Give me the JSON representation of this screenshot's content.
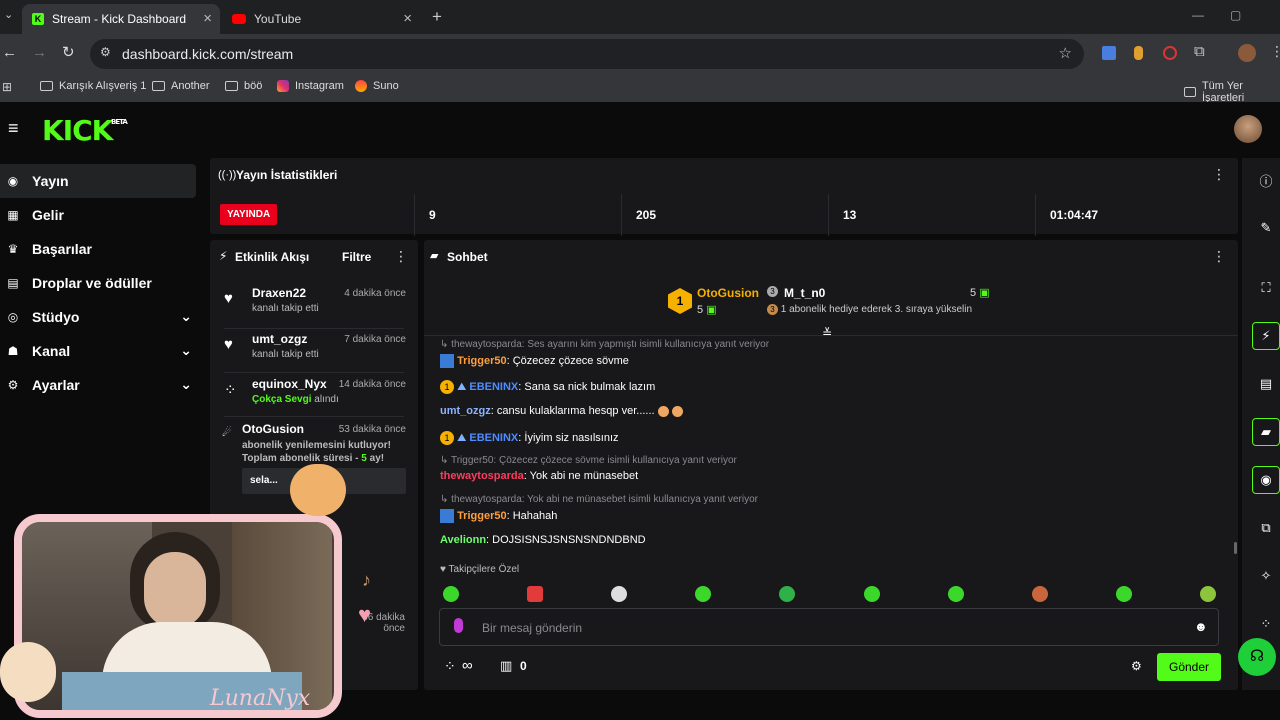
{
  "browser": {
    "tabs": [
      {
        "label": "Stream - Kick Dashboard",
        "active": true
      },
      {
        "label": "YouTube",
        "active": false
      }
    ],
    "url": "dashboard.kick.com/stream",
    "bookmarks": [
      "Karışık Alışveriş 1",
      "Another",
      "böö",
      "Instagram",
      "Suno"
    ],
    "bookmarks_right": "Tüm Yer İşaretleri"
  },
  "brand": {
    "logo": "KICK",
    "beta": "BETA",
    "accent": "#53fc18"
  },
  "sidebar": {
    "items": [
      {
        "label": "Yayın",
        "icon": "broadcast-icon",
        "active": true
      },
      {
        "label": "Gelir",
        "icon": "revenue-icon"
      },
      {
        "label": "Başarılar",
        "icon": "trophy-icon"
      },
      {
        "label": "Droplar ve ödüller",
        "icon": "gift-icon"
      },
      {
        "label": "Stüdyo",
        "icon": "studio-icon",
        "expandable": true
      },
      {
        "label": "Kanal",
        "icon": "channel-icon",
        "expandable": true
      },
      {
        "label": "Ayarlar",
        "icon": "gear-icon",
        "expandable": true
      }
    ]
  },
  "stats": {
    "title": "Yayın İstatistikleri",
    "live_badge": "YAYINDA",
    "values": [
      "9",
      "205",
      "13",
      "01:04:47"
    ]
  },
  "activity": {
    "title": "Etkinlik Akışı",
    "filter": "Filtre",
    "items": [
      {
        "name": "Draxen22",
        "time": "4 dakika önce",
        "text": "kanalı takip etti"
      },
      {
        "name": "umt_ozgz",
        "time": "7 dakika önce",
        "text": "kanalı takip etti"
      },
      {
        "name": "equinox_Nyx",
        "time": "14 dakika önce",
        "highlight": "Çokça Sevgi",
        "text": "alındı"
      },
      {
        "name": "OtoGusion",
        "time": "53 dakika önce",
        "line1": "abonelik yenilemesini kutluyor!",
        "line2a": "Toplam abonelik süresi -",
        "line2b": "5",
        "line2c": "ay!",
        "msg": "sela..."
      },
      {
        "time": "56 dakika önce"
      }
    ]
  },
  "chat": {
    "title": "Sohbet",
    "pinned": {
      "left_name": "OtoGusion",
      "left_count": "5",
      "left_rank": "1",
      "right_name": "M_t_n0",
      "right_count": "5",
      "right_rank": "3",
      "right_text": "1 abonelik hediye ederek 3. sıraya yükselin"
    },
    "messages": [
      {
        "reply": "thewaytosparda: Ses ayarını kim yapmıştı isimli kullanıcıya yanıt veriyor"
      },
      {
        "user": "Trigger50",
        "color": "#ff9e3d",
        "text": "Çözecez çözece sövme"
      },
      {
        "user": "EBENINX",
        "color": "#4f8cff",
        "text": "Sana sa nick bulmak lazım"
      },
      {
        "user": "umt_ozgz",
        "color": "#8ab4ff",
        "text": "cansu kulaklarıma hesqp ver......"
      },
      {
        "user": "EBENINX",
        "color": "#4f8cff",
        "text": "İyiyim siz nasılsınız"
      },
      {
        "reply": "Trigger50: Çözecez çözece sövme isimli kullanıcıya yanıt veriyor"
      },
      {
        "user": "thewaytosparda",
        "color": "#ff3b5c",
        "text": "Yok abi ne münasebet"
      },
      {
        "reply": "thewaytosparda: Yok abi ne münasebet isimli kullanıcıya yanıt veriyor"
      },
      {
        "user": "Trigger50",
        "color": "#ff9e3d",
        "text": "Hahahah"
      },
      {
        "user": "Avelionn",
        "color": "#6cff6c",
        "text": "DOJSISNSJSNSNSNDNDBND"
      }
    ],
    "followers_only": "Takipçilere Özel",
    "placeholder": "Bir mesaj gönderin",
    "points": "∞",
    "store_count": "0",
    "send": "Gönder"
  },
  "overlay": {
    "signature": "LunaNyx"
  }
}
